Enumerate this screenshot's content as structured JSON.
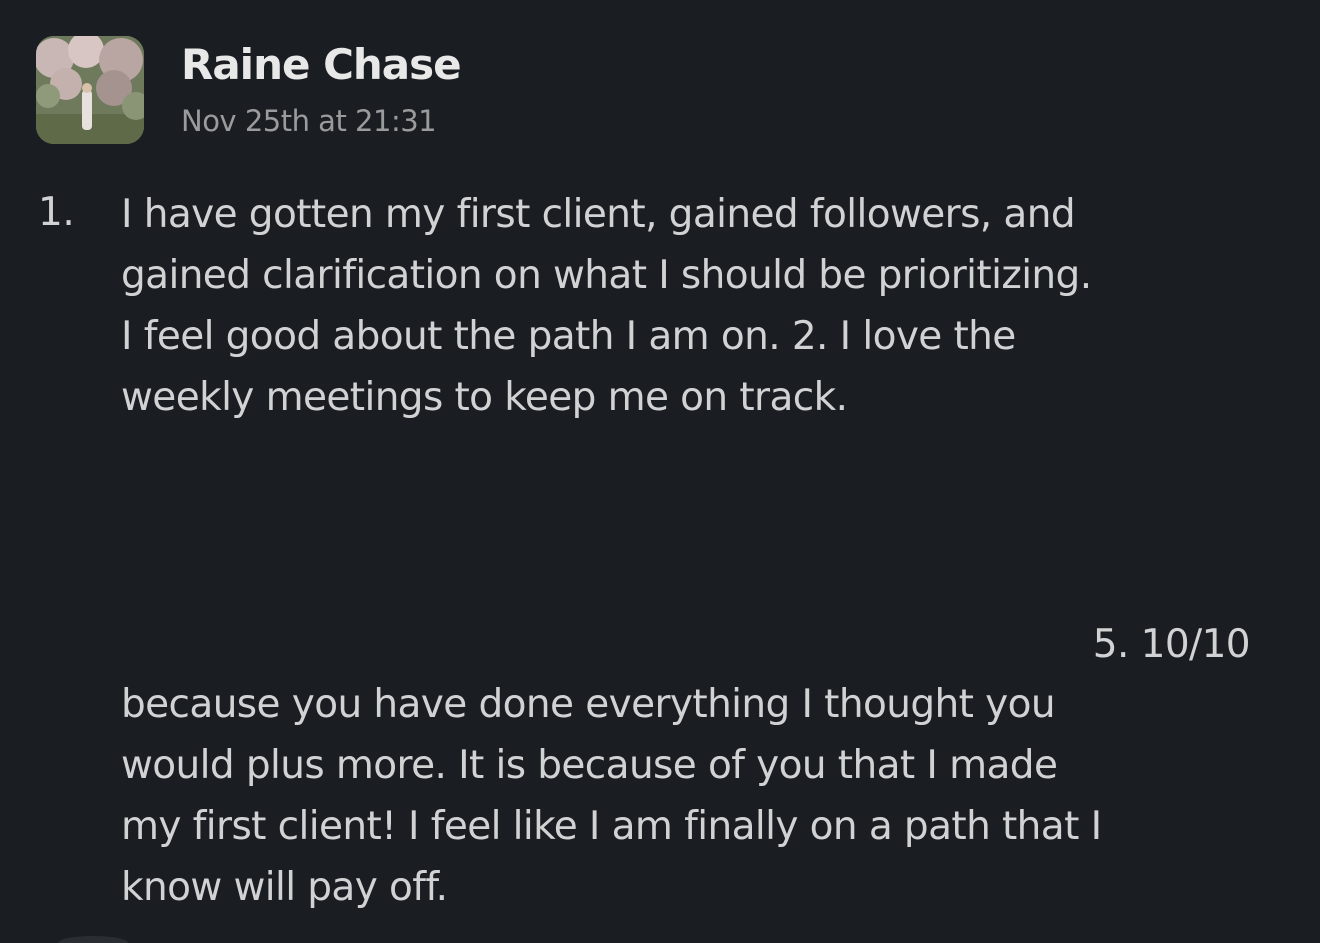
{
  "message": {
    "sender": "Raine Chase",
    "timestamp": "Nov 25th at 21:31",
    "avatar_icon": "user-avatar-photo",
    "list_number": "1.",
    "paragraph1_lines": [
      "I have gotten my first client, gained followers, and",
      "gained clarification on what I should be prioritizing.",
      "I feel good about the path I am on. 2. I love the",
      "weekly meetings to keep me on track."
    ],
    "rating": "5. 10/10",
    "paragraph2_lines": [
      "because you have done everything I thought you",
      "would plus more. It is because of you that I made",
      "my first client! I feel like I am finally on a path that I",
      "know will pay off."
    ]
  },
  "colors": {
    "background": "#1a1d21",
    "text": "#d1d2d3",
    "name": "#e8e8e8",
    "muted": "#9a9b9d"
  }
}
